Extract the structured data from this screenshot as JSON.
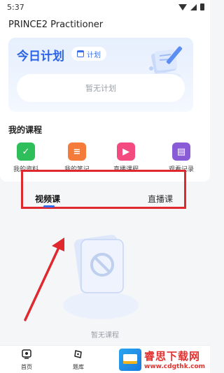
{
  "status_bar": {
    "time": "5:37"
  },
  "app": {
    "title": "PRINCE2 Practitioner"
  },
  "plan_card": {
    "title": "今日计划",
    "chip_label": "计划",
    "empty_text": "暂无计划"
  },
  "courses": {
    "section_title": "我的课程",
    "items": [
      {
        "label": "我的资料",
        "icon": "check-icon",
        "color": "#2fbf5a"
      },
      {
        "label": "我的笔记",
        "icon": "notes-icon",
        "color": "#f47b3a"
      },
      {
        "label": "直播课程",
        "icon": "play-icon",
        "color": "#f34b80"
      },
      {
        "label": "观看记录",
        "icon": "book-icon",
        "color": "#8a5bd6"
      }
    ]
  },
  "tabs": {
    "items": [
      {
        "label": "视频课",
        "active": true
      },
      {
        "label": "直播课",
        "active": false
      }
    ]
  },
  "empty_state": {
    "text": "暂无课程"
  },
  "bottom_nav": {
    "items": [
      {
        "label": "首页",
        "icon": "home-icon"
      },
      {
        "label": "题库",
        "icon": "question-bank-icon"
      }
    ]
  },
  "watermark": {
    "main": "睿思下载网",
    "sub": "www.cdgthk.com"
  },
  "colors": {
    "accent": "#2f6bea",
    "highlight_border": "#e0292f"
  }
}
